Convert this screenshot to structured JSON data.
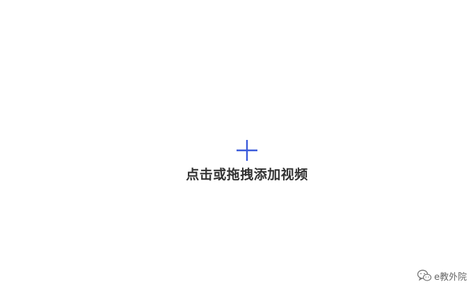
{
  "upload": {
    "prompt": "点击或拖拽添加视频",
    "icon": "plus-icon",
    "accent_color": "#3b5bdb"
  },
  "watermark": {
    "icon": "wechat-icon",
    "text": "e教外院"
  }
}
